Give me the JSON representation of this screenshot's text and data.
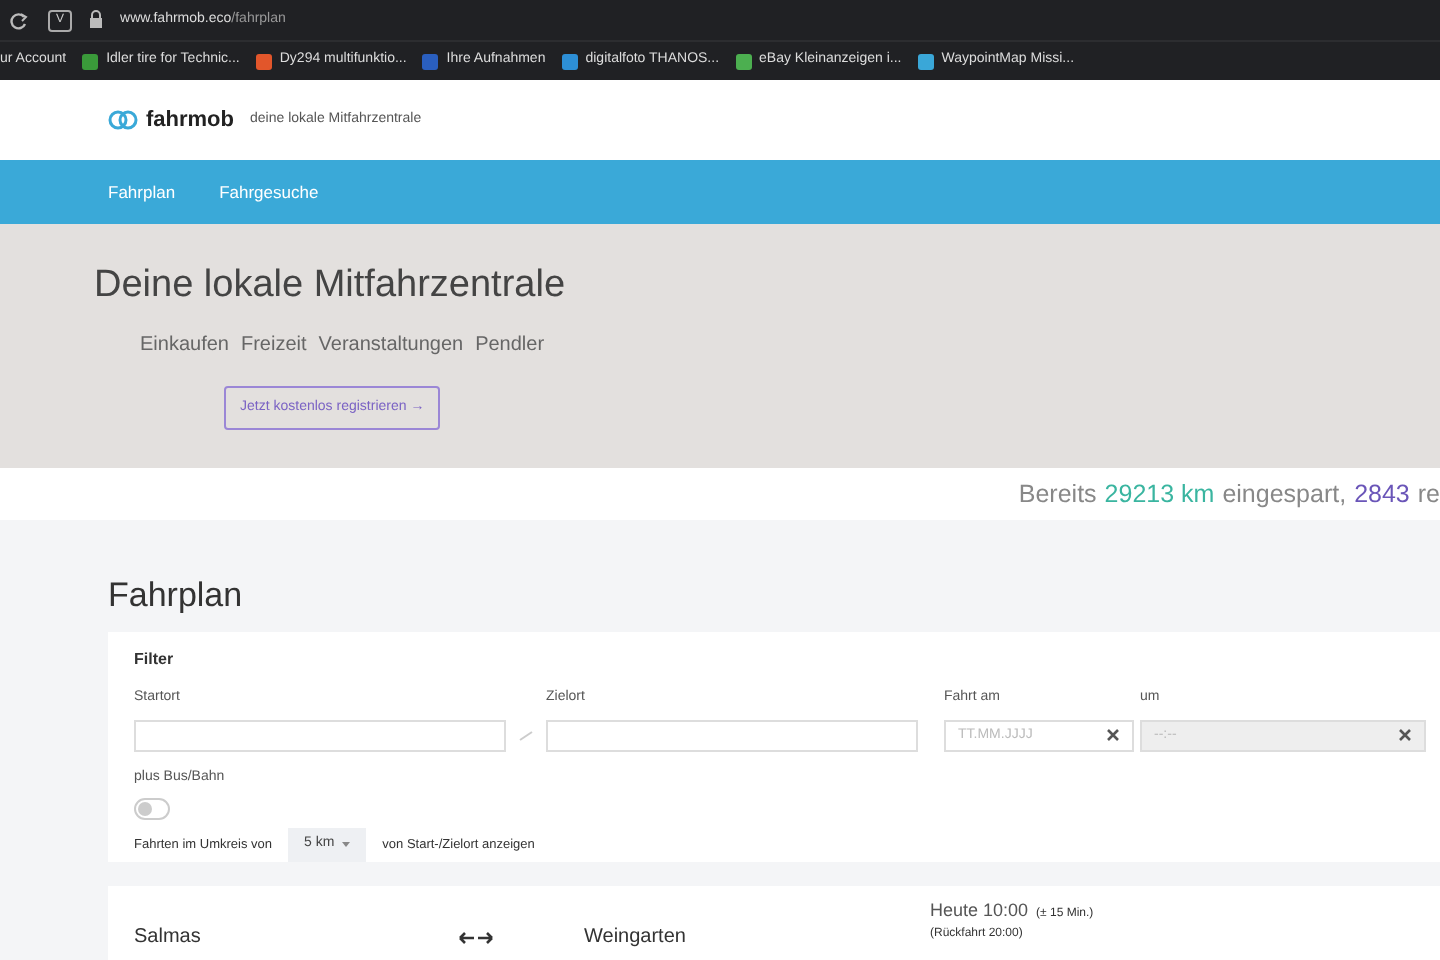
{
  "browser": {
    "url_host": "www.fahrmob.eco",
    "url_path": "/fahrplan",
    "profile": "V",
    "bookmarks": [
      {
        "label": "ur Account"
      },
      {
        "label": "Idler tire for Technic...",
        "color": "#3a9a3a"
      },
      {
        "label": "Dy294 multifunktio...",
        "color": "#e2562b"
      },
      {
        "label": "Ihre Aufnahmen",
        "color": "#2a5fbf"
      },
      {
        "label": "digitalfoto THANOS...",
        "color": "#2d8fd6"
      },
      {
        "label": "eBay Kleinanzeigen i...",
        "color": "#4caf50"
      },
      {
        "label": "WaypointMap Missi...",
        "color": "#3aa7d8"
      }
    ]
  },
  "header": {
    "brand": "fahrmob",
    "tagline": "deine lokale Mitfahrzentrale"
  },
  "nav": {
    "items": [
      {
        "label": "Fahrplan"
      },
      {
        "label": "Fahrgesuche"
      }
    ]
  },
  "hero": {
    "title": "Deine lokale Mitfahrzentrale",
    "tags": [
      "Einkaufen",
      "Freizeit",
      "Veranstaltungen",
      "Pendler"
    ],
    "button": "Jetzt kostenlos registrieren →"
  },
  "stats": {
    "segments": [
      {
        "text": "Bereits",
        "kind": "plain"
      },
      {
        "text": "29213 km",
        "kind": "km"
      },
      {
        "text": "eingespart,",
        "kind": "plain"
      },
      {
        "text": "2843",
        "kind": "count"
      },
      {
        "text": "re",
        "kind": "plain"
      }
    ]
  },
  "page_title": "Fahrplan",
  "filter": {
    "title": "Filter",
    "fields": [
      {
        "label": "Startort",
        "kind": "text",
        "disabled": false
      },
      {
        "label": "Zielort",
        "kind": "text",
        "disabled": false
      },
      {
        "label": "Fahrt am",
        "kind": "clearable",
        "placeholder": "TT.MM.JJJJ",
        "disabled": false
      },
      {
        "label": "um",
        "kind": "clearable",
        "placeholder": "--:--",
        "disabled": true
      }
    ],
    "bus": {
      "label": "plus Bus/Bahn",
      "on": false
    },
    "radius": {
      "prefix": "Fahrten im Umkreis von",
      "value": "5 km",
      "suffix": "von Start-/Zielort anzeigen"
    }
  },
  "rides": [
    {
      "from": "Salmas",
      "to": "Weingarten",
      "time": "Heute 10:00",
      "tolerance": "(± 15 Min.)",
      "return": "(Rückfahrt 20:00)"
    }
  ]
}
